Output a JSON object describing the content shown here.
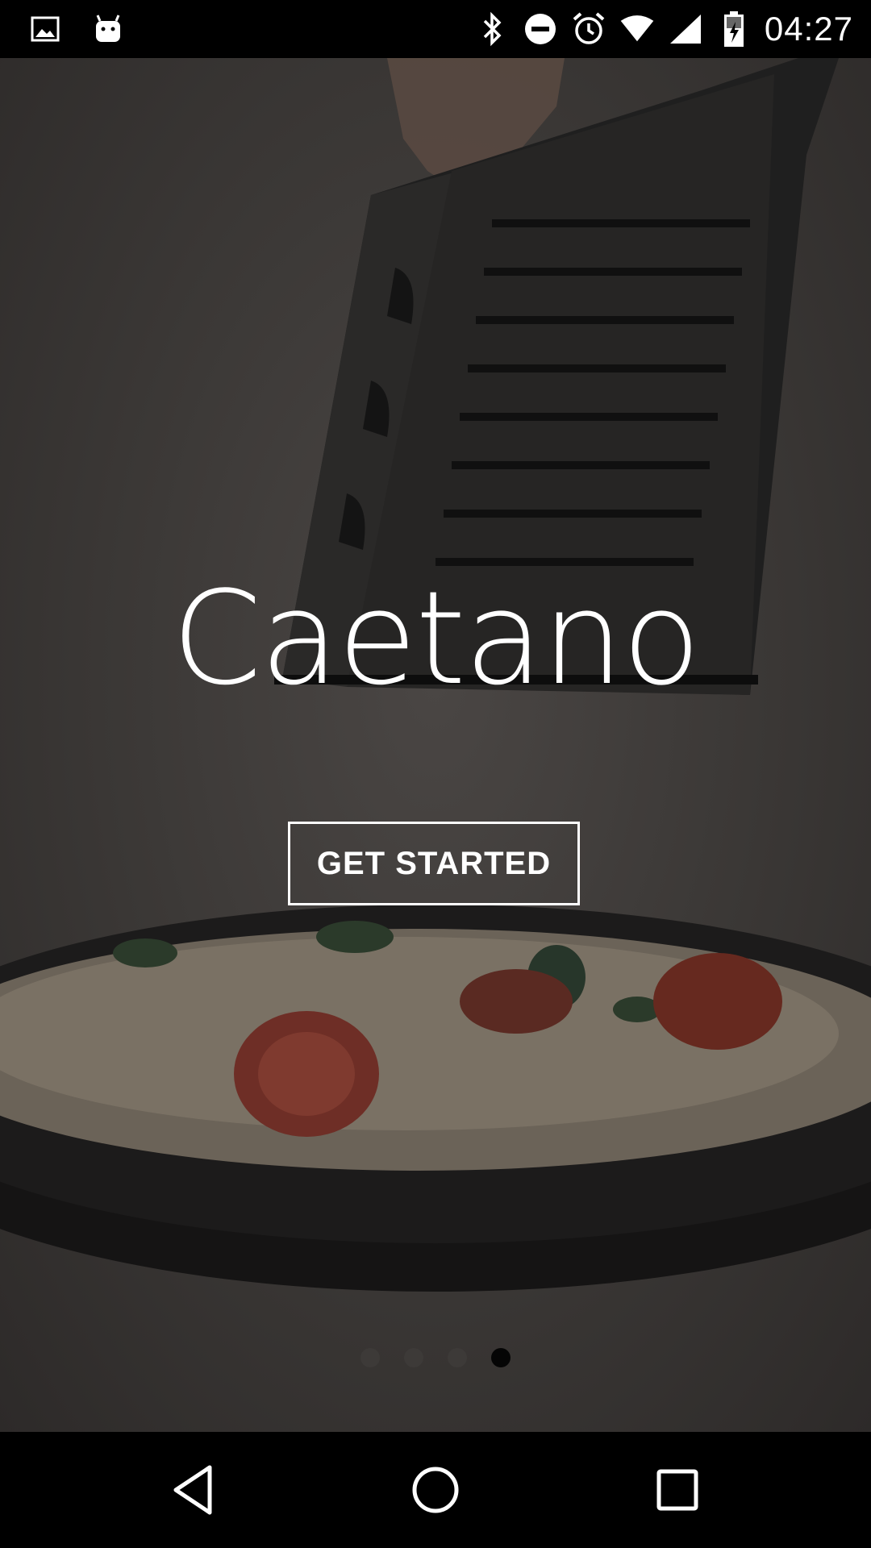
{
  "status_bar": {
    "time": "04:27",
    "left_icons": [
      "image-icon",
      "android-icon"
    ],
    "right_icons": [
      "bluetooth-icon",
      "do-not-disturb-icon",
      "alarm-icon",
      "wifi-icon",
      "signal-icon",
      "battery-icon"
    ]
  },
  "hero": {
    "brand": "Caetano",
    "cta_label": "GET STARTED",
    "pagination": {
      "total": 4,
      "active_index": 3
    }
  },
  "nav_bar": {
    "buttons": [
      "back-icon",
      "home-icon",
      "recents-icon"
    ]
  },
  "colors": {
    "overlay": "#3a3735",
    "text": "#ffffff",
    "dot_inactive": "#3d3a38",
    "dot_active": "#050505"
  }
}
